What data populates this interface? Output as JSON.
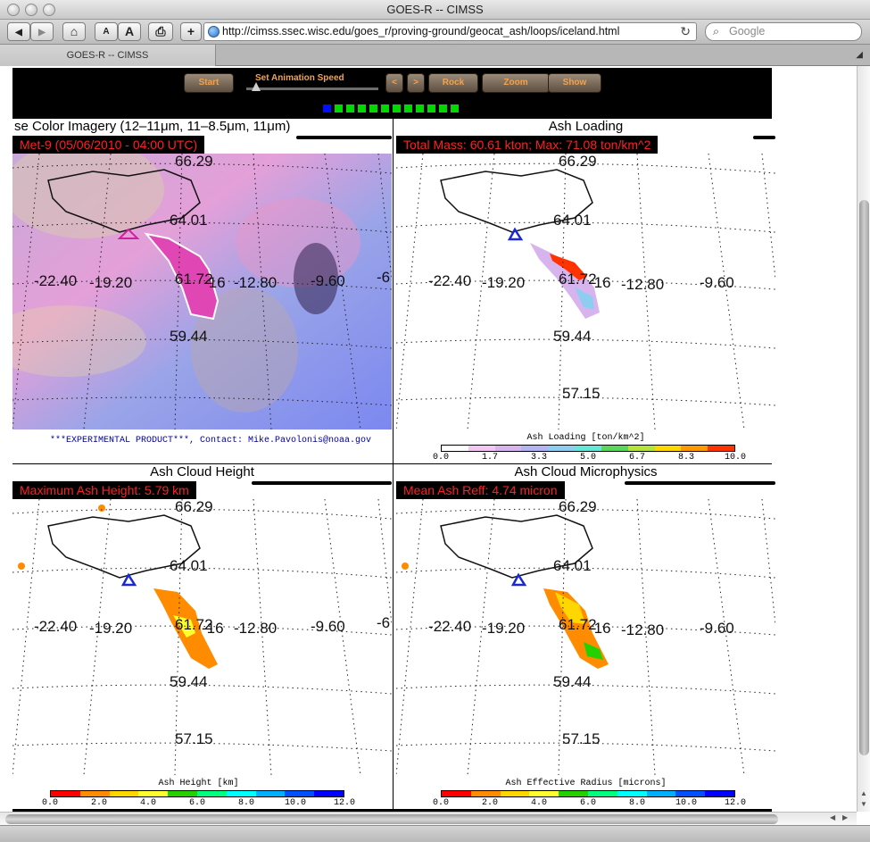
{
  "window": {
    "title": "GOES-R -- CIMSS"
  },
  "toolbar": {
    "back": "◀",
    "forward": "▶",
    "home": "⌂",
    "text_smaller": "A",
    "text_bigger": "A",
    "print": "⎙",
    "add": "+",
    "url": "http://cimss.ssec.wisc.edu/goes_r/proving-ground/geocat_ash/loops/iceland.html",
    "reload": "↻",
    "search_placeholder": "Google"
  },
  "tab": {
    "label": "GOES-R -- CIMSS"
  },
  "animation": {
    "start": "Start",
    "speed_label": "Set Animation Speed",
    "prev": "<",
    "next": ">",
    "rock": "Rock",
    "zoom": "Zoom",
    "show": "Show",
    "frame_count": 12,
    "current_frame": 1
  },
  "panels": {
    "false_color": {
      "title": "se Color Imagery (12–11μm, 11–8.5μm, 11μm)",
      "banner": "Met-9  (05/06/2010 - 04:00 UTC)",
      "credit": "***EXPERIMENTAL PRODUCT***, Contact: Mike.Pavolonis@noaa.gov"
    },
    "ash_loading": {
      "title": "Ash Loading",
      "banner": "Total Mass: 60.61 kton; Max: 71.08 ton/km^2",
      "colorbar_title": "Ash Loading [ton/km^2]",
      "ticks": [
        "0.0",
        "1.7",
        "3.3",
        "5.0",
        "6.7",
        "8.3",
        "10.0"
      ]
    },
    "ash_height": {
      "title": "Ash Cloud Height",
      "banner": "Maximum Ash Height: 5.79 km",
      "colorbar_title": "Ash Height [km]",
      "ticks": [
        "0.0",
        "2.0",
        "4.0",
        "6.0",
        "8.0",
        "10.0",
        "12.0"
      ]
    },
    "ash_micro": {
      "title": "Ash Cloud Microphysics",
      "banner": "Mean Ash Reff: 4.74 micron",
      "colorbar_title": "Ash Effective Radius [microns]",
      "ticks": [
        "0.0",
        "2.0",
        "4.0",
        "6.0",
        "8.0",
        "10.0",
        "12.0"
      ]
    }
  },
  "map_labels": {
    "lat_top": "66.29",
    "lat_2": "64.01",
    "lat_3": "61.72",
    "lat_4": "59.44",
    "lat_5": "57.15",
    "lon_1": "-22.40",
    "lon_2": "-19.20",
    "lon_3": "-16",
    "lon_4": "-12.80",
    "lon_5": "-9.60",
    "lon_6": "-6"
  },
  "colors": {
    "loading_scale": [
      "#ffffff",
      "#f4c6f4",
      "#d8b4ee",
      "#b4b4f2",
      "#8ccdf0",
      "#66e6d8",
      "#5ad65a",
      "#b4e43c",
      "#ffd700",
      "#ff9900",
      "#ff3300"
    ],
    "height_scale": [
      "#ff0000",
      "#ff8c00",
      "#ffd700",
      "#ffff30",
      "#24d000",
      "#00ff80",
      "#00ffff",
      "#00b0ff",
      "#0050ff",
      "#0000ff"
    ],
    "reff_scale": [
      "#ff0000",
      "#ff8c00",
      "#ffd700",
      "#ffff30",
      "#24d000",
      "#00ff80",
      "#00ffff",
      "#00b0ff",
      "#0050ff",
      "#0000ff"
    ]
  }
}
